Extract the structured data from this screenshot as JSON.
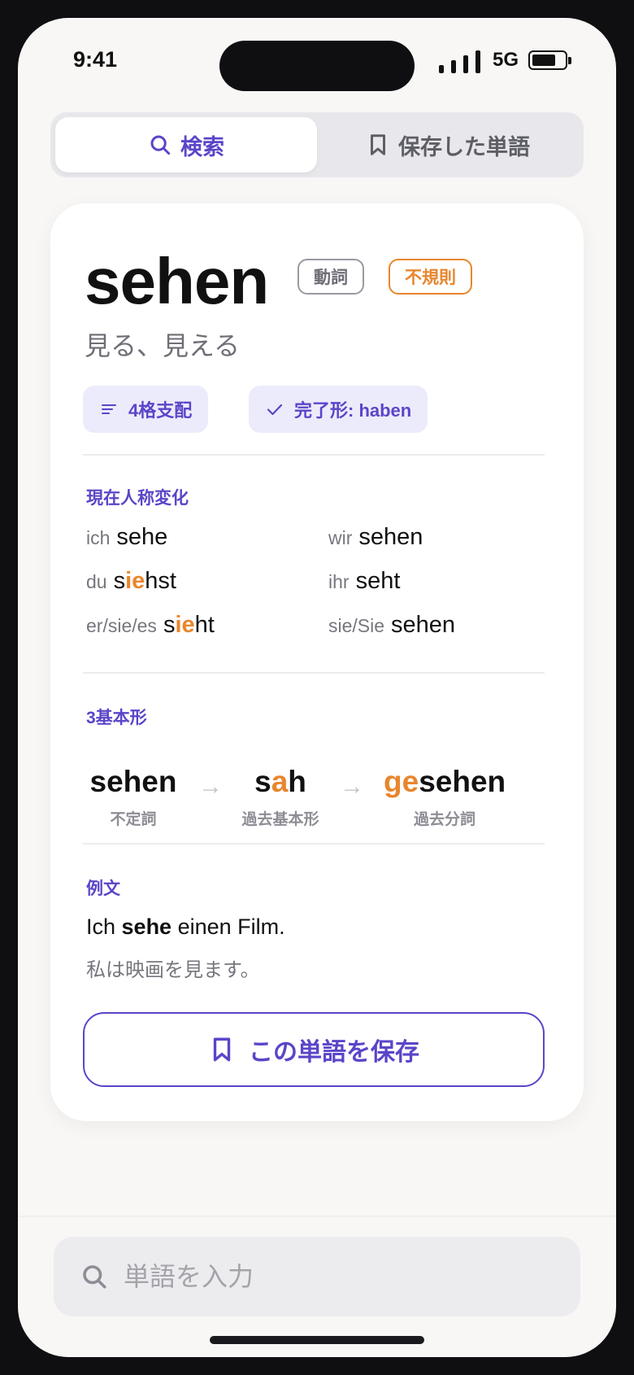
{
  "status_bar": {
    "time": "9:41",
    "network": "5G"
  },
  "tabs": [
    {
      "label": "検索",
      "icon": "search-icon",
      "active": true
    },
    {
      "label": "保存した単語",
      "icon": "bookmark-icon",
      "active": false
    }
  ],
  "entry": {
    "word": "sehen",
    "pos_badge": "動詞",
    "irregular_badge": "不規則",
    "meaning": "見る、見える",
    "chips": {
      "case": "4格支配",
      "perfect": "完了形: haben"
    }
  },
  "conjugation": {
    "title": "現在人称変化",
    "rows": [
      {
        "pronoun": "ich",
        "pre": "sehe",
        "hl": "",
        "post": ""
      },
      {
        "pronoun": "wir",
        "pre": "sehen",
        "hl": "",
        "post": ""
      },
      {
        "pronoun": "du",
        "pre": "s",
        "hl": "ie",
        "post": "hst"
      },
      {
        "pronoun": "ihr",
        "pre": "seht",
        "hl": "",
        "post": ""
      },
      {
        "pronoun": "er/sie/es",
        "pre": "s",
        "hl": "ie",
        "post": "ht"
      },
      {
        "pronoun": "sie/Sie",
        "pre": "sehen",
        "hl": "",
        "post": ""
      }
    ]
  },
  "principal_parts": {
    "title": "3基本形",
    "arrow": "→",
    "forms": [
      {
        "pre": "sehen",
        "hl": "",
        "post": "",
        "label": "不定詞"
      },
      {
        "pre": "s",
        "hl": "a",
        "post": "h",
        "label": "過去基本形"
      },
      {
        "pre": "",
        "hl": "ge",
        "post": "sehen",
        "label": "過去分詞"
      }
    ]
  },
  "example": {
    "title": "例文",
    "de_pre": "Ich ",
    "de_bold": "sehe",
    "de_post": " einen Film.",
    "ja": "私は映画を見ます。"
  },
  "save_button": {
    "label": "この単語を保存",
    "icon": "bookmark-icon"
  },
  "search": {
    "placeholder": "単語を入力",
    "value": ""
  },
  "colors": {
    "accent": "#5b45c8",
    "highlight": "#e8862d",
    "chip_bg": "#ecebfb"
  }
}
